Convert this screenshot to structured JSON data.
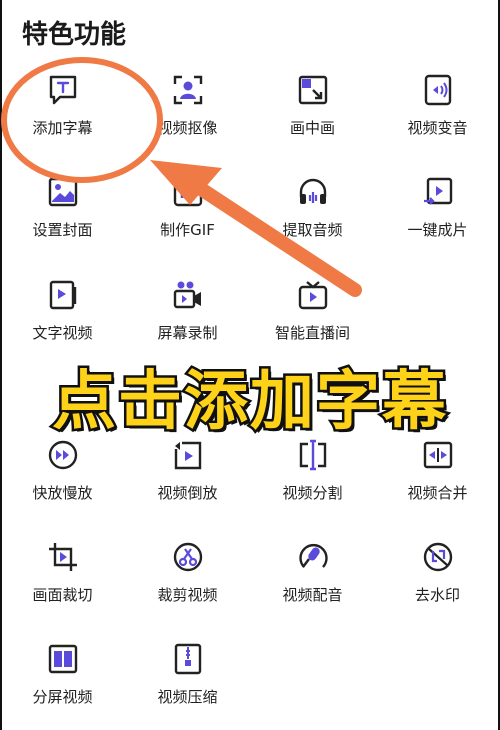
{
  "section_title": "特色功能",
  "accent_color": "#5B4BDB",
  "annotation_color": "#F07A45",
  "overlay_text_color": "#FFD21A",
  "overlay_text": "点击添加字幕",
  "features": [
    {
      "label": "添加字幕",
      "icon": "subtitle-icon"
    },
    {
      "label": "视频抠像",
      "icon": "portrait-cutout-icon"
    },
    {
      "label": "画中画",
      "icon": "picture-in-picture-icon"
    },
    {
      "label": "视频变音",
      "icon": "voice-change-icon"
    },
    {
      "label": "设置封面",
      "icon": "cover-icon"
    },
    {
      "label": "制作GIF",
      "icon": "gif-icon"
    },
    {
      "label": "提取音频",
      "icon": "headphones-icon"
    },
    {
      "label": "一键成片",
      "icon": "one-click-video-icon"
    },
    {
      "label": "文字视频",
      "icon": "text-video-icon"
    },
    {
      "label": "屏幕录制",
      "icon": "screen-record-icon"
    },
    {
      "label": "智能直播间",
      "icon": "live-tv-icon"
    },
    {
      "label": "快放慢放",
      "icon": "speed-icon"
    },
    {
      "label": "视频倒放",
      "icon": "reverse-icon"
    },
    {
      "label": "视频分割",
      "icon": "split-icon"
    },
    {
      "label": "视频合并",
      "icon": "merge-icon"
    },
    {
      "label": "画面裁切",
      "icon": "crop-icon"
    },
    {
      "label": "裁剪视频",
      "icon": "trim-icon"
    },
    {
      "label": "视频配音",
      "icon": "dubbing-icon"
    },
    {
      "label": "去水印",
      "icon": "remove-watermark-icon"
    },
    {
      "label": "分屏视频",
      "icon": "split-screen-icon"
    },
    {
      "label": "视频压缩",
      "icon": "compress-icon"
    }
  ]
}
